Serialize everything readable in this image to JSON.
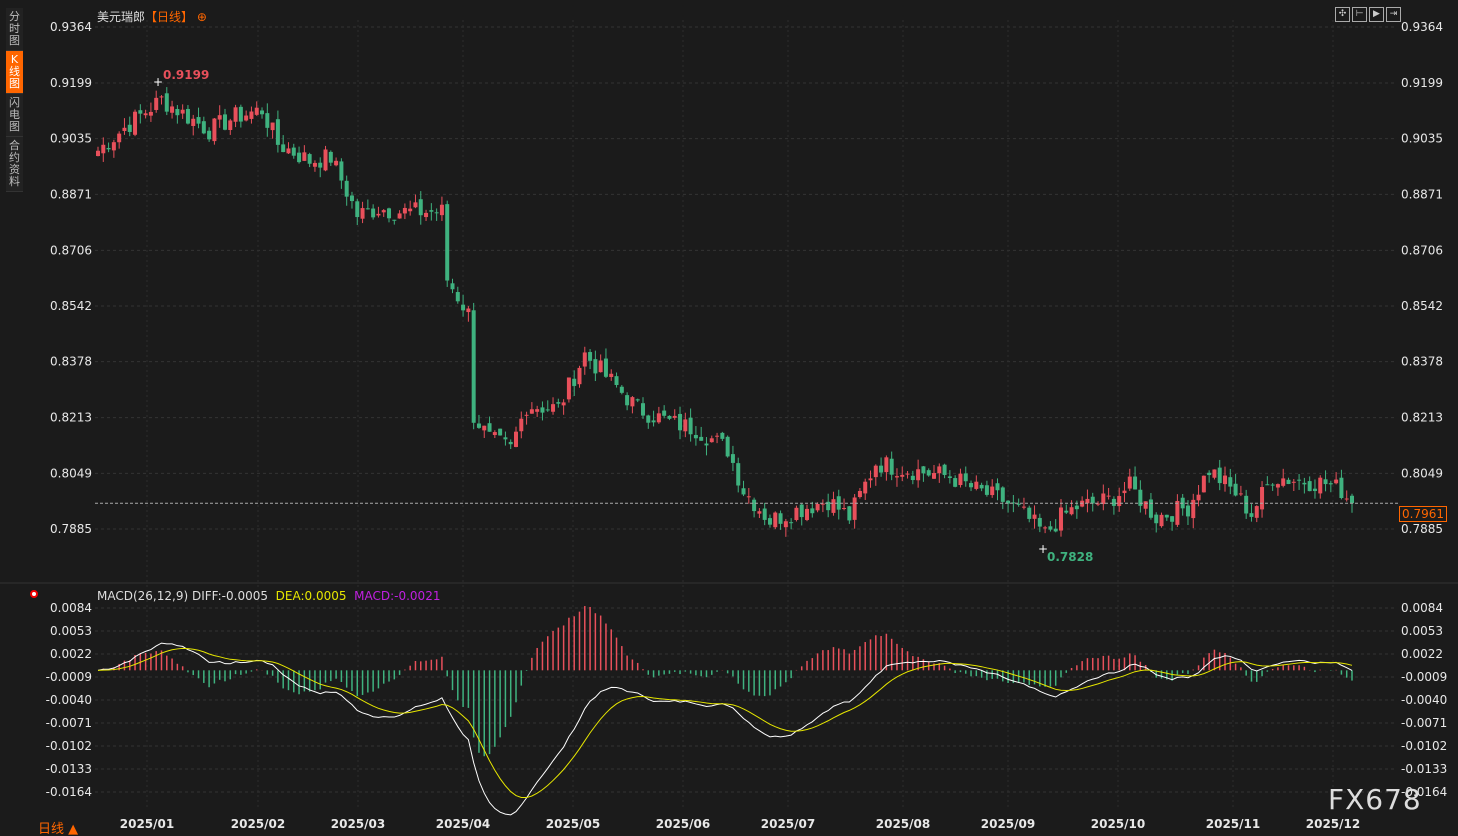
{
  "sidebar": {
    "items": [
      {
        "label": "分\n时\n图",
        "active": false
      },
      {
        "label": "K\n线\n图",
        "active": true
      },
      {
        "label": "闪\n电\n图",
        "active": false
      },
      {
        "label": "合\n约\n资\n料",
        "active": false
      }
    ]
  },
  "header": {
    "symbol": "美元瑞郎",
    "period": "【日线】",
    "icon": "crosshair-circle-icon"
  },
  "toolbar_icons": [
    "fit-icon",
    "zoom-in-icon",
    "zoom-out-icon",
    "export-icon"
  ],
  "footer": {
    "period_selector": "日线 ▲",
    "watermark": "FX678"
  },
  "colors": {
    "up": "#e8505b",
    "down": "#3fb27f",
    "diff": "#ffffff",
    "dea": "#e6e600",
    "macd": "#c020e0",
    "accent": "#ff6600"
  },
  "chart_data": [
    {
      "type": "candlestick",
      "title": "美元瑞郎【日线】",
      "y_ticks": [
        "0.9364",
        "0.9199",
        "0.9035",
        "0.8871",
        "0.8706",
        "0.8542",
        "0.8378",
        "0.8213",
        "0.8049",
        "0.7885"
      ],
      "ylim": [
        0.7885,
        0.9364
      ],
      "x_ticks": [
        "2025/01",
        "2025/02",
        "2025/03",
        "2025/04",
        "2025/05",
        "2025/06",
        "2025/07",
        "2025/08",
        "2025/09",
        "2025/10",
        "2025/11",
        "2025/12"
      ],
      "high_label": "0.9199",
      "low_label": "0.7828",
      "current_price": "0.7961",
      "close_anchors": [
        [
          0,
          0.9
        ],
        [
          6,
          0.908
        ],
        [
          12,
          0.915
        ],
        [
          15,
          0.912
        ],
        [
          21,
          0.906
        ],
        [
          26,
          0.91
        ],
        [
          31,
          0.912
        ],
        [
          34,
          0.902
        ],
        [
          40,
          0.897
        ],
        [
          44,
          0.898
        ],
        [
          47,
          0.888
        ],
        [
          49,
          0.881
        ],
        [
          53,
          0.883
        ],
        [
          57,
          0.882
        ],
        [
          65,
          0.882
        ],
        [
          66,
          0.862
        ],
        [
          70,
          0.852
        ],
        [
          71,
          0.822
        ],
        [
          74,
          0.815
        ],
        [
          78,
          0.812
        ],
        [
          81,
          0.825
        ],
        [
          87,
          0.824
        ],
        [
          92,
          0.84
        ],
        [
          97,
          0.832
        ],
        [
          102,
          0.824
        ],
        [
          108,
          0.82
        ],
        [
          113,
          0.818
        ],
        [
          119,
          0.812
        ],
        [
          122,
          0.8
        ],
        [
          127,
          0.791
        ],
        [
          132,
          0.794
        ],
        [
          138,
          0.797
        ],
        [
          142,
          0.792
        ],
        [
          147,
          0.808
        ],
        [
          153,
          0.806
        ],
        [
          161,
          0.804
        ],
        [
          166,
          0.8
        ],
        [
          171,
          0.797
        ],
        [
          174,
          0.794
        ],
        [
          179,
          0.787
        ],
        [
          182,
          0.792
        ],
        [
          185,
          0.795
        ],
        [
          191,
          0.797
        ],
        [
          195,
          0.801
        ],
        [
          200,
          0.792
        ],
        [
          206,
          0.795
        ],
        [
          210,
          0.806
        ],
        [
          215,
          0.799
        ],
        [
          218,
          0.793
        ],
        [
          222,
          0.804
        ],
        [
          226,
          0.803
        ],
        [
          232,
          0.802
        ],
        [
          235,
          0.8
        ],
        [
          237,
          0.7961
        ]
      ]
    },
    {
      "type": "macd",
      "label": "MACD(26,12,9)",
      "diff": "DIFF:-0.0005",
      "dea": "DEA:0.0005",
      "macd": "MACD:-0.0021",
      "y_ticks": [
        "0.0084",
        "0.0053",
        "0.0022",
        "-0.0009",
        "-0.0040",
        "-0.0071",
        "-0.0102",
        "-0.0133",
        "-0.0164"
      ],
      "ylim": [
        -0.0164,
        0.0084
      ]
    }
  ]
}
